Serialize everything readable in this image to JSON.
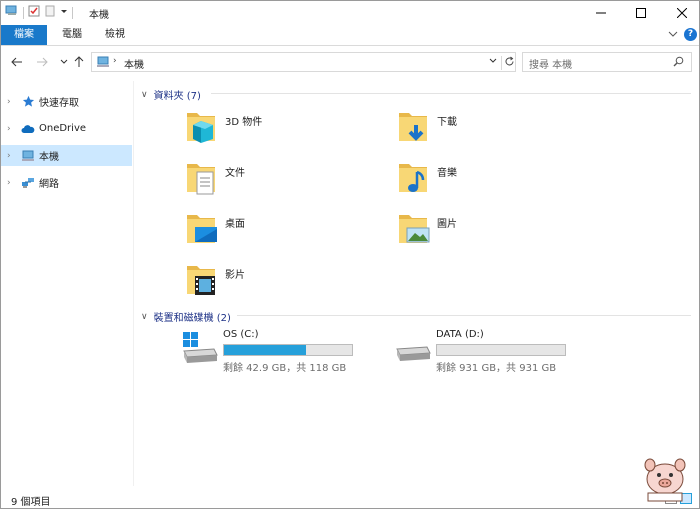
{
  "window": {
    "title": "本機"
  },
  "ribbon": {
    "tabs": [
      {
        "label": "檔案"
      },
      {
        "label": "電腦"
      },
      {
        "label": "檢視"
      }
    ],
    "help_label": "?"
  },
  "address": {
    "crumb": "本機",
    "search_placeholder": "搜尋 本機"
  },
  "sidebar": {
    "items": [
      {
        "label": "快速存取",
        "icon": "star-icon"
      },
      {
        "label": "OneDrive",
        "icon": "cloud-icon"
      },
      {
        "label": "本機",
        "icon": "computer-icon",
        "selected": true
      },
      {
        "label": "網路",
        "icon": "network-icon"
      }
    ]
  },
  "content": {
    "folders_header": "資料夾 (7)",
    "folders": [
      {
        "name": "3D 物件",
        "icon": "3d-objects-folder-icon"
      },
      {
        "name": "下載",
        "icon": "downloads-folder-icon"
      },
      {
        "name": "文件",
        "icon": "documents-folder-icon"
      },
      {
        "name": "音樂",
        "icon": "music-folder-icon"
      },
      {
        "name": "桌面",
        "icon": "desktop-folder-icon"
      },
      {
        "name": "圖片",
        "icon": "pictures-folder-icon"
      },
      {
        "name": "影片",
        "icon": "videos-folder-icon"
      }
    ],
    "drives_header": "裝置和磁碟機 (2)",
    "drives": [
      {
        "name": "OS (C:)",
        "free_text": "剩餘 42.9 GB，共 118 GB",
        "used_fraction": 0.64,
        "icon": "windows-drive-icon"
      },
      {
        "name": "DATA (D:)",
        "free_text": "剩餘 931 GB，共 931 GB",
        "used_fraction": 0.0,
        "icon": "hard-drive-icon"
      }
    ]
  },
  "status": {
    "count": "9 個項目"
  },
  "colors": {
    "accent": "#1979ca",
    "selection": "#cce8ff",
    "drive_fill": "#26a0da",
    "group_header": "#1e3287"
  }
}
